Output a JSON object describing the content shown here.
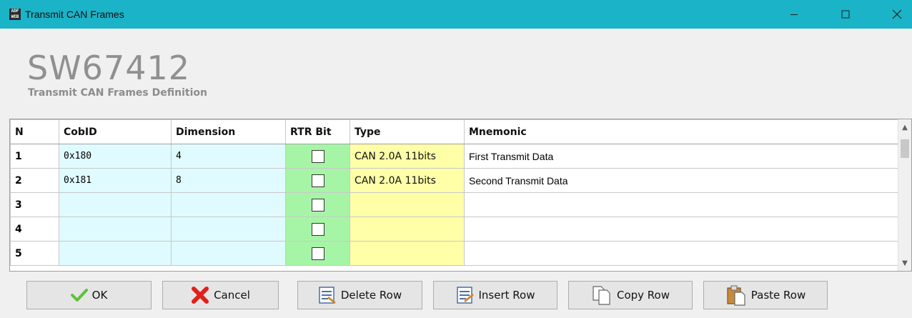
{
  "window": {
    "title": "Transmit CAN Frames",
    "app_icon_text": "ADF WEB"
  },
  "heading": {
    "title": "SW67412",
    "subtitle": "Transmit CAN Frames Definition"
  },
  "table": {
    "columns": [
      "N",
      "CobID",
      "Dimension",
      "RTR Bit",
      "Type",
      "Mnemonic"
    ],
    "rows": [
      {
        "n": "1",
        "cobid": "0x180",
        "dimension": "4",
        "rtr": false,
        "type": "CAN 2.0A 11bits",
        "mnemonic": "First Transmit Data"
      },
      {
        "n": "2",
        "cobid": "0x181",
        "dimension": "8",
        "rtr": false,
        "type": "CAN 2.0A 11bits",
        "mnemonic": "Second Transmit Data"
      },
      {
        "n": "3",
        "cobid": "",
        "dimension": "",
        "rtr": false,
        "type": "",
        "mnemonic": ""
      },
      {
        "n": "4",
        "cobid": "",
        "dimension": "",
        "rtr": false,
        "type": "",
        "mnemonic": ""
      },
      {
        "n": "5",
        "cobid": "",
        "dimension": "",
        "rtr": false,
        "type": "",
        "mnemonic": ""
      }
    ]
  },
  "buttons": {
    "ok": "OK",
    "cancel": "Cancel",
    "delete_row": "Delete Row",
    "insert_row": "Insert Row",
    "copy_row": "Copy Row",
    "paste_row": "Paste Row"
  },
  "colors": {
    "titlebar": "#1ab3c8",
    "cobid_cells": "#e0fbff",
    "rtr_cells": "#a6f5a6",
    "type_cells": "#ffffa8"
  }
}
